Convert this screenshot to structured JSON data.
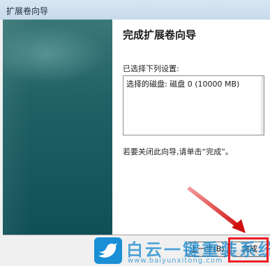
{
  "window": {
    "title": "扩展卷向导"
  },
  "wizard": {
    "heading": "完成扩展卷向导",
    "selection_label": "已选择下列设置:",
    "summary_lines": [
      "选择的磁盘: 磁盘 0 (10000 MB)"
    ],
    "finish_note": "若要关闭此向导,请单击“完成”。"
  },
  "buttons": {
    "back": "上一步(B)",
    "finish": "完成"
  },
  "watermark": {
    "title": "白云一键重装系统",
    "url": "www.baiyunxitong.com"
  },
  "colors": {
    "highlight": "#ee1c25",
    "side_panel": "#1f6165",
    "watermark": "#1689d0"
  },
  "icons": {
    "watermark_logo": "bird-icon"
  }
}
